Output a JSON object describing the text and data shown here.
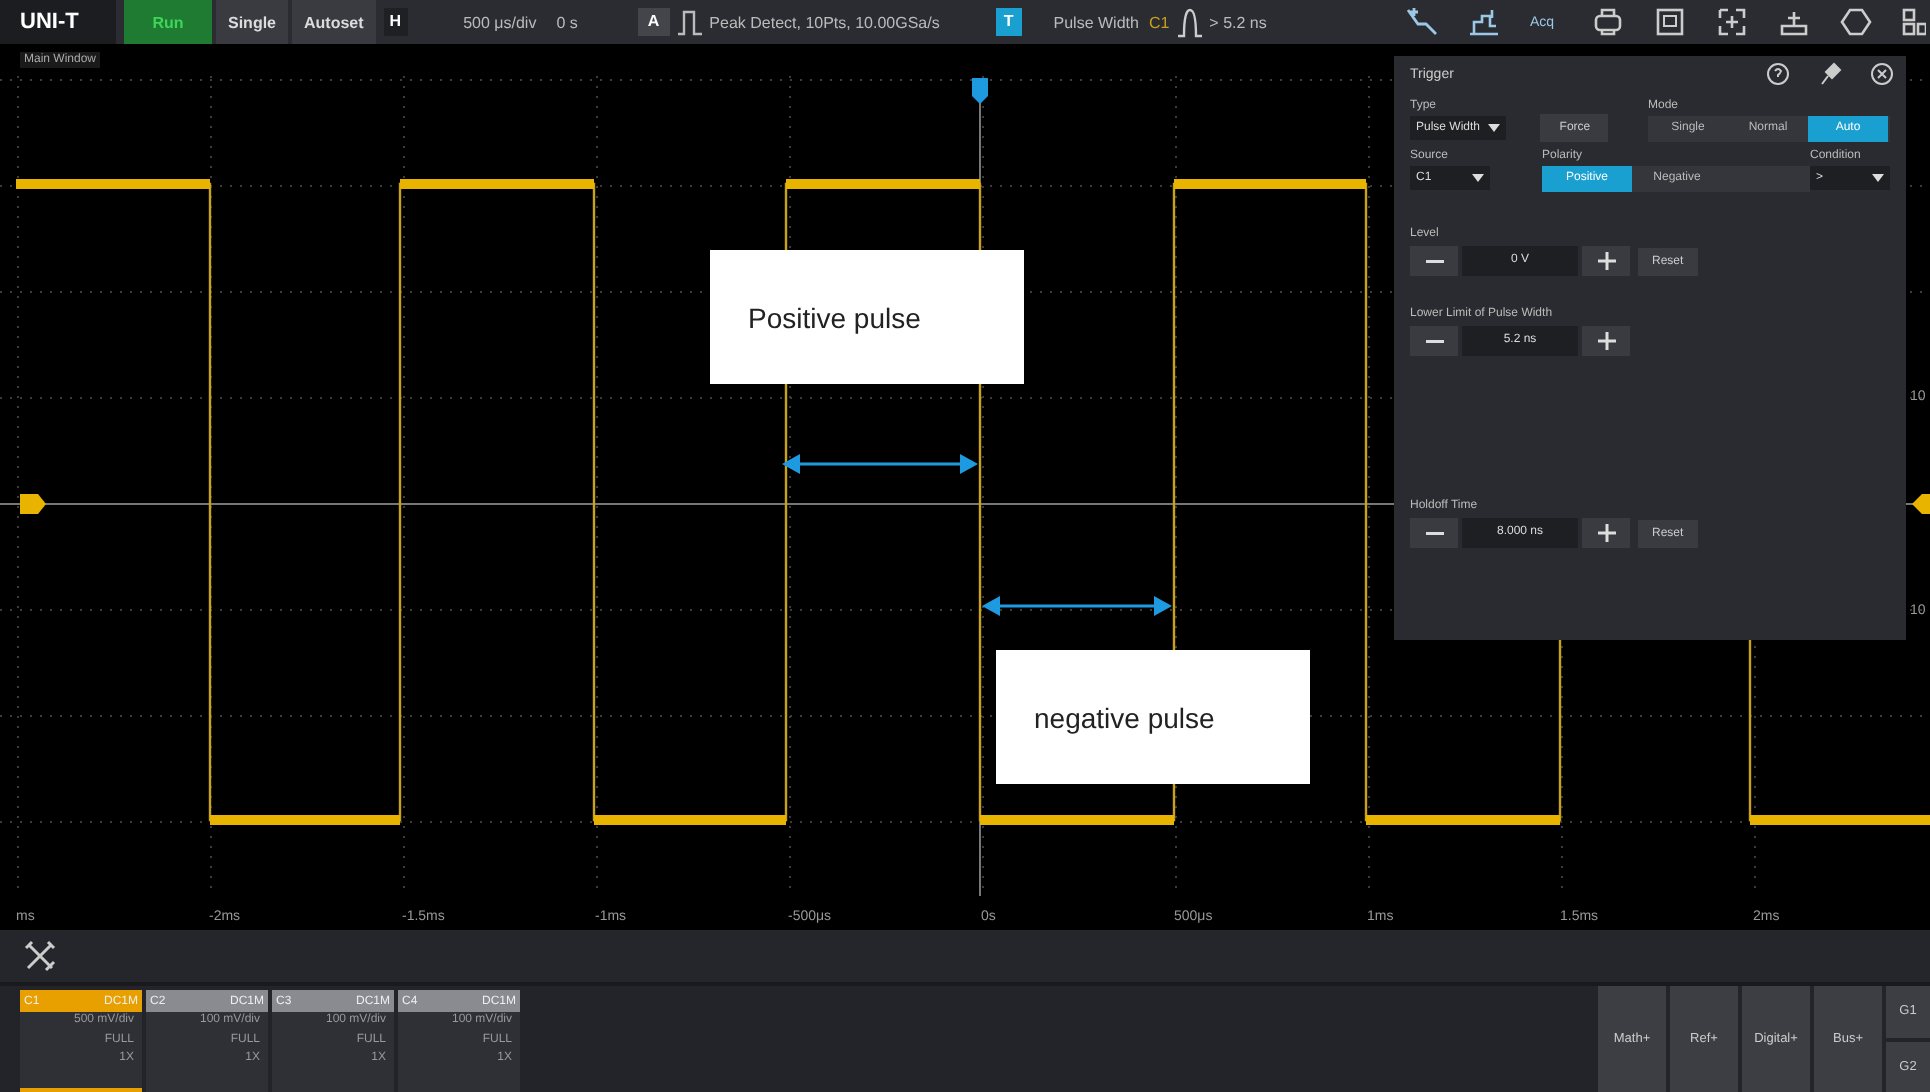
{
  "top_bar": {
    "logo": "UNI-T",
    "run_button": {
      "label": "Run",
      "running": true
    },
    "buttons": [
      "Single",
      "Autoset"
    ],
    "horizontal": {
      "badge": "H",
      "timebase": "500 μs/div",
      "offset": "0 s"
    },
    "acquisition": {
      "badge": "A",
      "mode": "Peak Detect, 10Pts, 10.00GSa/s"
    },
    "trigger_status": {
      "badge": "T",
      "type": "Pulse Width",
      "source": "C1",
      "condition": "> 5.2 ns"
    },
    "acq_icon_label": "Acq"
  },
  "window_label": "Main Window",
  "display": {
    "time_labels": [
      "ms",
      "-2ms",
      "-1.5ms",
      "-1ms",
      "-500μs",
      "0s",
      "500μs",
      "1ms",
      "1.5ms",
      "2ms"
    ],
    "scale_labels": [
      "10",
      "10"
    ],
    "annotations": [
      {
        "text": "Positive pulse"
      },
      {
        "text": "negative pulse"
      }
    ]
  },
  "trigger_panel": {
    "title": "Trigger",
    "type": {
      "label": "Type",
      "value": "Pulse Width"
    },
    "force": "Force",
    "mode": {
      "label": "Mode",
      "options": [
        {
          "label": "Single",
          "selected": false
        },
        {
          "label": "Normal",
          "selected": false
        },
        {
          "label": "Auto",
          "selected": true
        }
      ]
    },
    "source": {
      "label": "Source",
      "value": "C1"
    },
    "polarity": {
      "label": "Polarity",
      "options": [
        {
          "label": "Positive",
          "selected": true
        },
        {
          "label": "Negative",
          "selected": false
        }
      ]
    },
    "condition": {
      "label": "Condition",
      "value": ">"
    },
    "level": {
      "label": "Level",
      "value": "0 V",
      "reset": "Reset"
    },
    "lower_limit": {
      "label": "Lower Limit of Pulse Width",
      "value": "5.2 ns"
    },
    "holdoff": {
      "label": "Holdoff Time",
      "value": "8.000 ns",
      "reset": "Reset"
    }
  },
  "channels": [
    {
      "name": "C1",
      "coupling": "DC1M",
      "scale": "500 mV/div",
      "bandwidth": "FULL",
      "probe": "1X",
      "selected": true
    },
    {
      "name": "C2",
      "coupling": "DC1M",
      "scale": "100 mV/div",
      "bandwidth": "FULL",
      "probe": "1X",
      "selected": false
    },
    {
      "name": "C3",
      "coupling": "DC1M",
      "scale": "100 mV/div",
      "bandwidth": "FULL",
      "probe": "1X",
      "selected": false
    },
    {
      "name": "C4",
      "coupling": "DC1M",
      "scale": "100 mV/div",
      "bandwidth": "FULL",
      "probe": "1X",
      "selected": false
    }
  ],
  "bottom_buttons": [
    "Math+",
    "Ref+",
    "Digital+",
    "Bus+"
  ],
  "groups": [
    "G1",
    "G2"
  ]
}
